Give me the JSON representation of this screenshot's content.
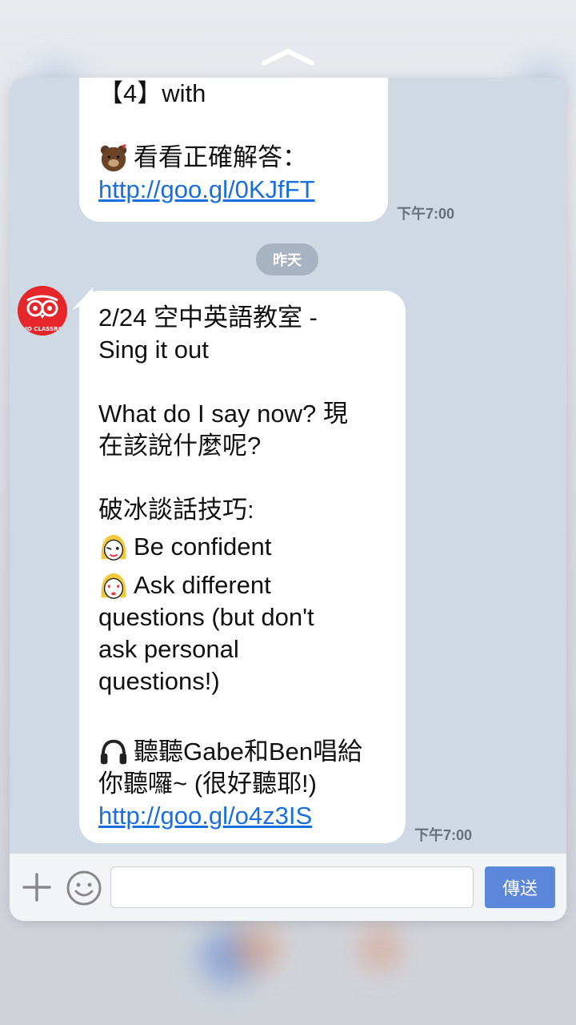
{
  "colors": {
    "accent": "#5b87db",
    "link": "#1a6fe0",
    "chat_bg": "#cfd9e4",
    "avatar_bg": "#e5262b"
  },
  "message1": {
    "line1": "【4】with",
    "line2": "看看正確解答：",
    "link": "http://goo.gl/0KJfFT",
    "time": "下午7:00"
  },
  "date_separator": "昨天",
  "avatar": {
    "icon": "owl-logo-icon",
    "text": "RADIO CLASSROOM"
  },
  "message2": {
    "title_line1": "2/24 空中英語教室 -",
    "title_line2": "Sing it out",
    "q_line1": "What do I say now? 現",
    "q_line2": "在該說什麼呢?",
    "tips_title": "破冰談話技巧:",
    "tip1": "Be confident",
    "tip2_line1": "Ask different",
    "tip2_line2": "questions (but don't",
    "tip2_line3": "ask personal",
    "tip2_line4": "questions!)",
    "listen_line1": "聽聽Gabe和Ben唱給",
    "listen_line2": "你聽囉~ (很好聽耶!)",
    "link": "http://goo.gl/o4z3IS",
    "time": "下午7:00"
  },
  "input_bar": {
    "plus_icon": "plus-icon",
    "emoji_icon": "smiley-icon",
    "placeholder": "",
    "send_label": "傳送"
  }
}
